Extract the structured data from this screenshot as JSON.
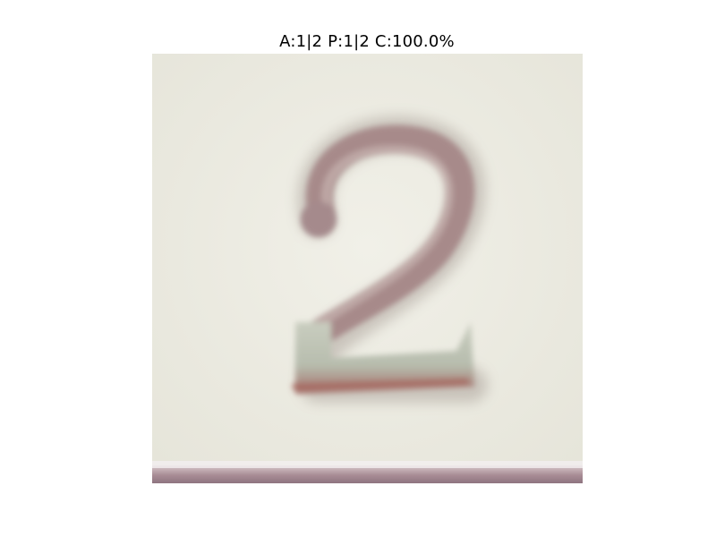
{
  "figure": {
    "title": "A:1|2 P:1|2 C:100.0%"
  },
  "image": {
    "subject": "digit-two-tile",
    "depicted_digit": "2",
    "colors": {
      "background": "#ecebe2",
      "digit_stroke": "#a78a8a",
      "digit_shadow": "#8c7f78",
      "bottom_band": "#a88c95"
    }
  }
}
